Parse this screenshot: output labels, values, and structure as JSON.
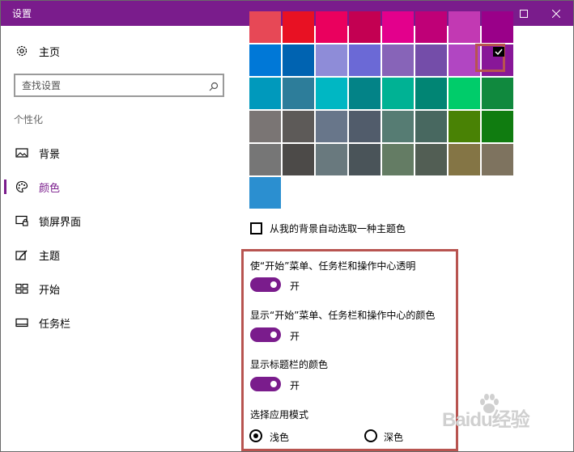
{
  "window": {
    "title": "设置",
    "titlebar_color": "#7a1c8c"
  },
  "sidebar": {
    "home_label": "主页",
    "search_placeholder": "查找设置",
    "section_label": "个性化",
    "items": [
      {
        "label": "背景",
        "icon": "picture-icon"
      },
      {
        "label": "颜色",
        "icon": "palette-icon",
        "active": true
      },
      {
        "label": "锁屏界面",
        "icon": "lock-screen-icon"
      },
      {
        "label": "主题",
        "icon": "theme-icon"
      },
      {
        "label": "开始",
        "icon": "start-icon"
      },
      {
        "label": "任务栏",
        "icon": "taskbar-icon"
      }
    ]
  },
  "colors": {
    "rows": [
      [
        "#e74856",
        "#e81123",
        "#ea005e",
        "#c30052",
        "#e3008c",
        "#bf0077",
        "#c239b3",
        "#9a0089"
      ],
      [
        "#0078d7",
        "#0063b1",
        "#8e8cd8",
        "#6b69d6",
        "#8764b8",
        "#744da9",
        "#b146c2",
        "#881798"
      ],
      [
        "#0099bc",
        "#2d7d9a",
        "#00b7c3",
        "#038387",
        "#00b294",
        "#018574",
        "#00cc6a",
        "#10893e"
      ],
      [
        "#7a7574",
        "#5d5a58",
        "#68768a",
        "#515c6b",
        "#567c73",
        "#486860",
        "#498205",
        "#107c10"
      ],
      [
        "#767676",
        "#4c4a48",
        "#69797e",
        "#4a5459",
        "#647c64",
        "#525e54",
        "#847545",
        "#7e735f"
      ],
      [
        "#2b8fd0"
      ]
    ],
    "selected_color": "#881798"
  },
  "auto_pick": {
    "label": "从我的背景自动选取一种主题色",
    "checked": false
  },
  "options": {
    "transparency": {
      "label": "使“开始”菜单、任务栏和操作中心透明",
      "state": "开"
    },
    "show_color_start": {
      "label": "显示“开始”菜单、任务栏和操作中心的颜色",
      "state": "开"
    },
    "show_color_title": {
      "label": "显示标题栏的颜色",
      "state": "开"
    },
    "app_mode": {
      "label": "选择应用模式",
      "light": "浅色",
      "dark": "深色",
      "selected": "浅色"
    }
  },
  "watermark": {
    "text": "Baidu经验"
  }
}
